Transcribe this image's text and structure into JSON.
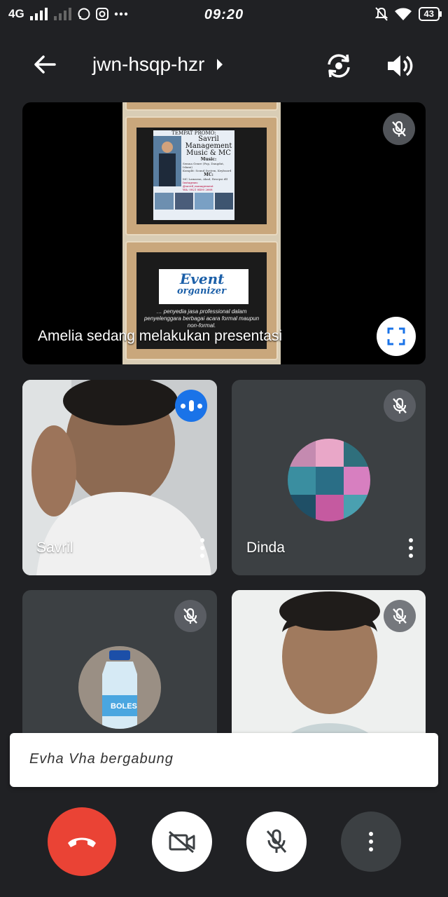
{
  "status_bar": {
    "network": "4G",
    "time": "09:20",
    "battery": "43",
    "icons": [
      "signal-icon",
      "whatsapp-icon",
      "instagram-icon",
      "more-icon",
      "notifications-off-icon",
      "wifi-icon",
      "battery-icon"
    ]
  },
  "header": {
    "meeting_code": "jwn-hsqp-hzr"
  },
  "presentation": {
    "label": "Amelia sedang melakukan presentasi",
    "slide_1": {
      "promo_head": "TEMPAT PROMO:",
      "promo_title": "Savril Management Music & MC",
      "music_label": "Music:",
      "music_desc": "Semua Genre (Pop, Dangdut, Islami)",
      "equipment": "Komplit: Sound System, Keyboard",
      "mc_label": "MC:",
      "mc_desc": "MC Lamaran, Akad, Resepsi dll",
      "instagram_label": "Instagram:",
      "instagram": "@savril_management",
      "wa": "WA: 0821 8400 2668"
    },
    "slide_2": {
      "logo_line1": "Event",
      "logo_line2": "organizer",
      "desc": "… penyedia jasa professional dalam penyelenggara berbagai acara formal maupun non-formal."
    }
  },
  "participants": [
    {
      "name": "Savril",
      "speaking": true
    },
    {
      "name": "Dinda",
      "muted": true
    },
    {
      "name": "",
      "muted": true,
      "avatar_text": "BOLES"
    },
    {
      "name": "",
      "muted": true
    }
  ],
  "toast": {
    "message": "Evha Vha bergabung"
  },
  "colors": {
    "background": "#202124",
    "tile": "#3c4043",
    "end_call": "#ea4335",
    "speaking": "#1a73e8"
  }
}
